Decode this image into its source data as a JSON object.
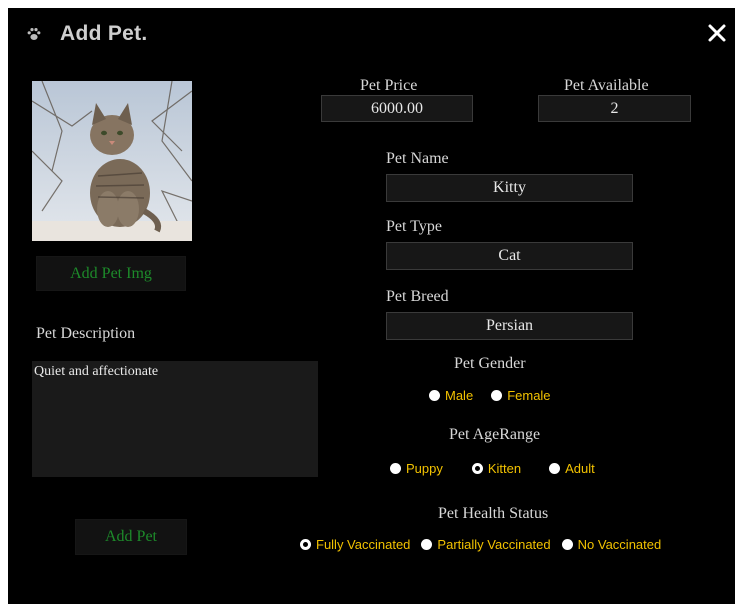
{
  "window": {
    "title": "Add Pet.",
    "icons": {
      "title": "paw-icon",
      "close": "close-icon"
    }
  },
  "image_panel": {
    "image": "cat-photo",
    "add_image_label": "Add Pet Img"
  },
  "description": {
    "label": "Pet Description",
    "value": "Quiet and affectionate"
  },
  "add_button_label": "Add Pet",
  "fields": {
    "price": {
      "label": "Pet Price",
      "value": "6000.00"
    },
    "available": {
      "label": "Pet Available",
      "value": "2"
    },
    "name": {
      "label": "Pet Name",
      "value": "Kitty"
    },
    "type": {
      "label": "Pet Type",
      "value": "Cat"
    },
    "breed": {
      "label": "Pet Breed",
      "value": "Persian"
    }
  },
  "gender": {
    "label": "Pet Gender",
    "options": [
      "Male",
      "Female"
    ],
    "selected": null
  },
  "age_range": {
    "label": "Pet AgeRange",
    "options": [
      "Puppy",
      "Kitten",
      "Adult"
    ],
    "selected": "Kitten"
  },
  "health": {
    "label": "Pet Health Status",
    "options": [
      "Fully Vaccinated",
      "Partially Vaccinated",
      "No Vaccinated"
    ],
    "selected": "Fully Vaccinated"
  },
  "colors": {
    "background": "#000000",
    "field_bg": "#171717",
    "radio_text": "#f2c200",
    "button_text": "#1d8a2a"
  }
}
